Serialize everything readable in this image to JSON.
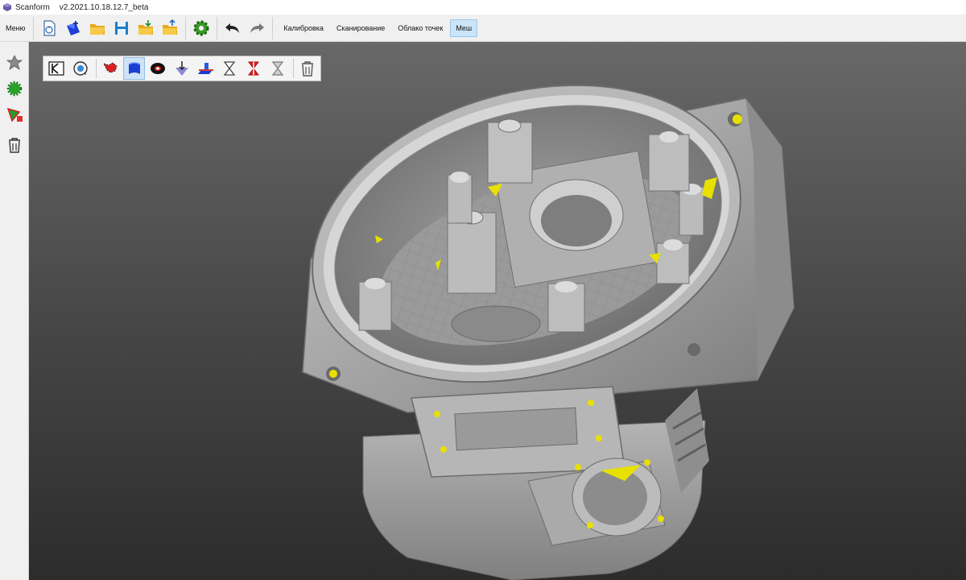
{
  "titlebar": {
    "app_name": "Scanform",
    "version": "v2.2021.10.18.12.7_beta"
  },
  "toolbar": {
    "menu_label": "Меню",
    "icons": [
      "new-project-icon",
      "add-scan-icon",
      "open-folder-icon",
      "save-icon",
      "import-icon",
      "export-icon",
      "settings-icon",
      "undo-icon",
      "redo-icon"
    ],
    "tabs": [
      {
        "label": "Калибровка",
        "active": false
      },
      {
        "label": "Сканирование",
        "active": false
      },
      {
        "label": "Облако точек",
        "active": false
      },
      {
        "label": "Меш",
        "active": true
      }
    ]
  },
  "sidebar": {
    "icons": [
      "mesh-star-icon",
      "mesh-green-blob-icon",
      "mesh-edit-icon",
      "trash-icon"
    ]
  },
  "mesh_toolbar": {
    "icons": [
      "k-frame-icon",
      "view-rotate-icon",
      "select-brush-icon",
      "surface-select-icon",
      "ring-icon",
      "down-arrow-icon",
      "plane-cut-icon",
      "hourglass-outline-icon",
      "hourglass-red-icon",
      "hourglass-gray-icon",
      "trash-icon"
    ],
    "active_index": 3
  },
  "colors": {
    "viewport_top": "#686868",
    "viewport_bottom": "#2c2c2c",
    "mesh_surface": "#a8a8a8",
    "mesh_highlight": "#e2e2e2",
    "mesh_hole": "#e8e000",
    "active_tab": "#cce4f7"
  }
}
